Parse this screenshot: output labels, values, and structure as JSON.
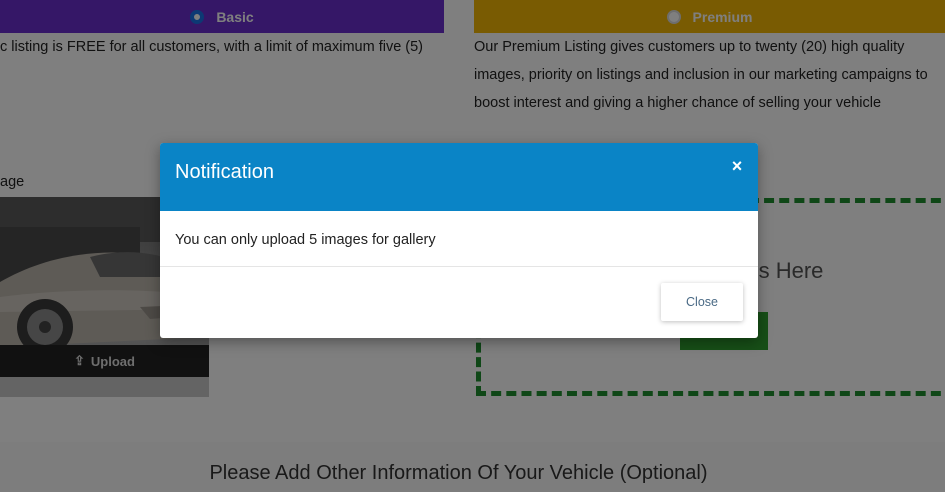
{
  "plans": {
    "basic": {
      "label": "Basic",
      "selected": true,
      "description": "c listing is FREE for all customers, with a limit of maximum five (5)"
    },
    "premium": {
      "label": "Premium",
      "selected": false,
      "description": "Our Premium Listing gives customers up to twenty (20) high quality images, priority on listings and inclusion in our marketing campaigns to boost interest and giving a higher chance of selling your vehicle"
    }
  },
  "gallery": {
    "label": "age",
    "upload_label": "Upload"
  },
  "dropzone": {
    "text": "otos Here"
  },
  "other_info_heading": "Please Add Other Information Of Your Vehicle (Optional)",
  "modal": {
    "title": "Notification",
    "close_icon": "×",
    "message": "You can only upload 5 images for gallery",
    "close_button": "Close"
  },
  "colors": {
    "basic_tab": "#6b2fcf",
    "premium_tab": "#f2b705",
    "modal_header": "#0a84c6",
    "dropzone_border": "#1f8f2f"
  }
}
